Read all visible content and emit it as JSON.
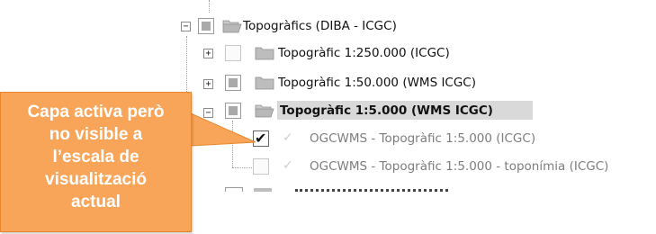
{
  "tree": {
    "root": {
      "label": "Topogràfics (DIBA - ICGC)",
      "expander": "−"
    },
    "children": [
      {
        "label": "Topogràfic 1:250.000 (ICGC)",
        "expander": "+"
      },
      {
        "label": "Topogràfic 1:50.000 (WMS ICGC)",
        "expander": "+"
      },
      {
        "label": "Topogràfic 1:5.000 (WMS ICGC)",
        "expander": "−"
      }
    ],
    "sublayers": [
      {
        "label": "OGCWMS - Topogràfic 1:5.000 (ICGC)",
        "checkmark": "✓"
      },
      {
        "label": "OGCWMS - Topogràfic 1:5.000 - toponímia (ICGC)",
        "checkmark": "✓"
      }
    ]
  },
  "callout": {
    "text": "Capa activa però no visible a l’escala de visualització actual",
    "lines": [
      "Capa activa però",
      "no visible a",
      "l’escala de",
      "visualització",
      "actual"
    ],
    "fill": "#f8a55a",
    "border": "#e9862d"
  },
  "colors": {
    "selection": "#d9d9d9",
    "folder": "#b8b8b8",
    "muted_text": "#7d7d7d"
  }
}
